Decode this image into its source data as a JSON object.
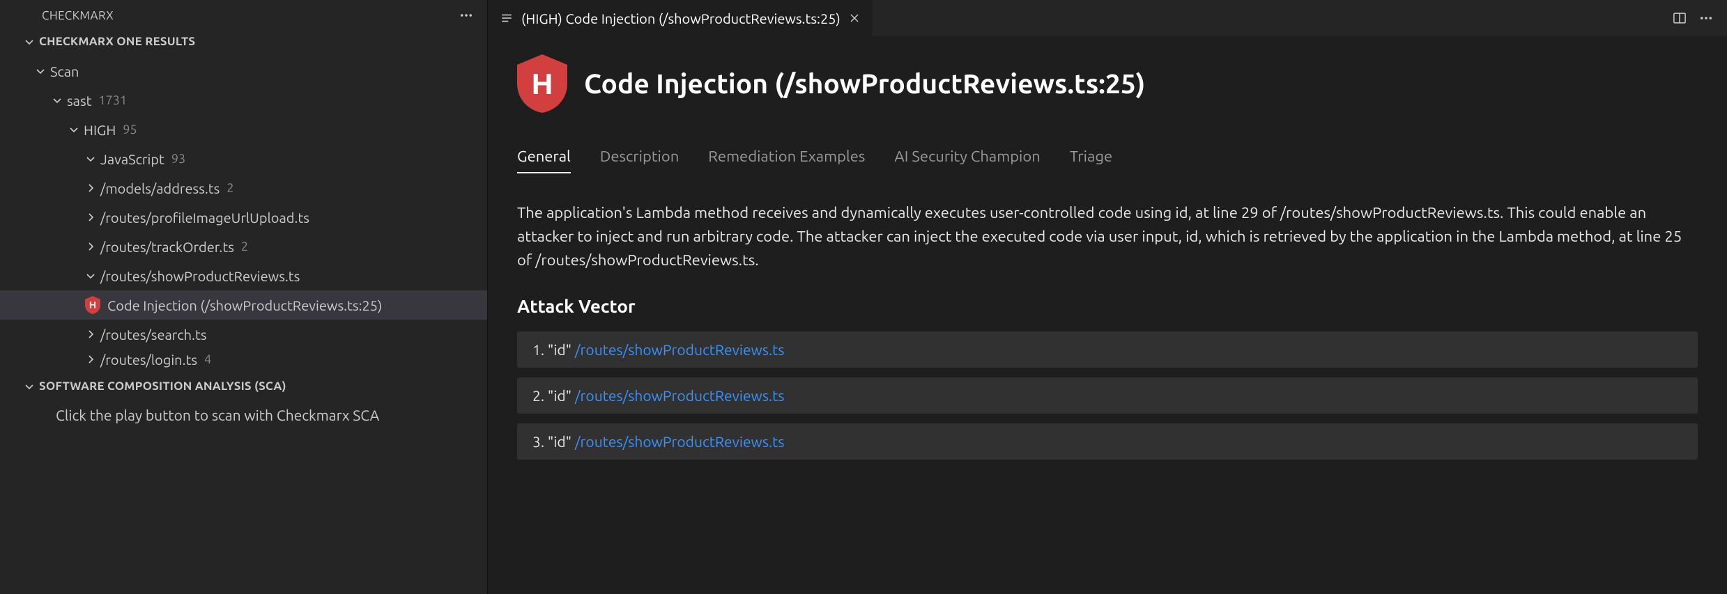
{
  "sidebar": {
    "panel_title": "CHECKMARX",
    "results_title": "CHECKMARX ONE RESULTS",
    "scan_label": "Scan",
    "sast_label": "sast",
    "sast_count": "1731",
    "high_label": "HIGH",
    "high_count": "95",
    "js_label": "JavaScript",
    "js_count": "93",
    "files": [
      {
        "name": "/models/address.ts",
        "count": "2"
      },
      {
        "name": "/routes/profileImageUrlUpload.ts",
        "count": ""
      },
      {
        "name": "/routes/trackOrder.ts",
        "count": "2"
      },
      {
        "name": "/routes/showProductReviews.ts",
        "count": ""
      },
      {
        "name": "Code Injection (/showProductReviews.ts:25)",
        "count": "",
        "selected": true,
        "badge": "H"
      },
      {
        "name": "/routes/search.ts",
        "count": ""
      },
      {
        "name": "/routes/login.ts",
        "count": "4"
      }
    ],
    "sca_title": "SOFTWARE COMPOSITION ANALYSIS (SCA)",
    "sca_text": "Click the play button to scan with Checkmarx SCA"
  },
  "editor": {
    "tab_title": "(HIGH) Code Injection (/showProductReviews.ts:25)",
    "page_title": "Code Injection (/showProductReviews.ts:25)",
    "subtabs": [
      "General",
      "Description",
      "Remediation Examples",
      "AI Security Champion",
      "Triage"
    ],
    "description": "The application's Lambda method receives and dynamically executes user-controlled code using id, at line 29 of /routes/showProductReviews.ts. This could enable an attacker to inject and run arbitrary code. The attacker can inject the executed code via user input, id, which is retrieved by the application in the Lambda method, at line 25 of /routes/showProductReviews.ts.",
    "attack_vector_title": "Attack Vector",
    "attack_vector": [
      {
        "n": "1.",
        "label": "\"id\"",
        "link": "/routes/showProductReviews.ts"
      },
      {
        "n": "2.",
        "label": "\"id\"",
        "link": "/routes/showProductReviews.ts"
      },
      {
        "n": "3.",
        "label": "\"id\"",
        "link": "/routes/showProductReviews.ts"
      }
    ]
  }
}
